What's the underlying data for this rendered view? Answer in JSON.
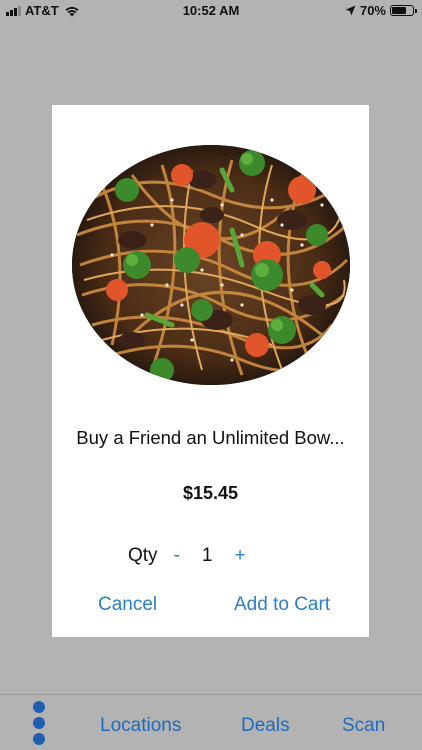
{
  "status_bar": {
    "carrier": "AT&T",
    "time": "10:52 AM",
    "battery": "70%",
    "battery_level": 0.7,
    "icons": [
      "signal-icon",
      "wifi-icon",
      "location-arrow-icon",
      "battery-icon"
    ]
  },
  "modal": {
    "image_icon": "noodle-bowl-image",
    "title": "Buy a Friend an Unlimited Bow...",
    "price": "$15.45",
    "qty_label": "Qty",
    "qty_minus": "-",
    "qty_value": "1",
    "qty_plus": "+",
    "cancel_label": "Cancel",
    "add_to_cart_label": "Add to Cart"
  },
  "tab_bar": {
    "more_icon": "more-dots-icon",
    "items": [
      {
        "label": "Locations"
      },
      {
        "label": "Deals"
      },
      {
        "label": "Scan"
      }
    ]
  },
  "colors": {
    "accent": "#2a7fc9",
    "tab_accent": "#1f6bbf",
    "overlay_background": "#b3b3b3",
    "card_background": "#ffffff"
  }
}
